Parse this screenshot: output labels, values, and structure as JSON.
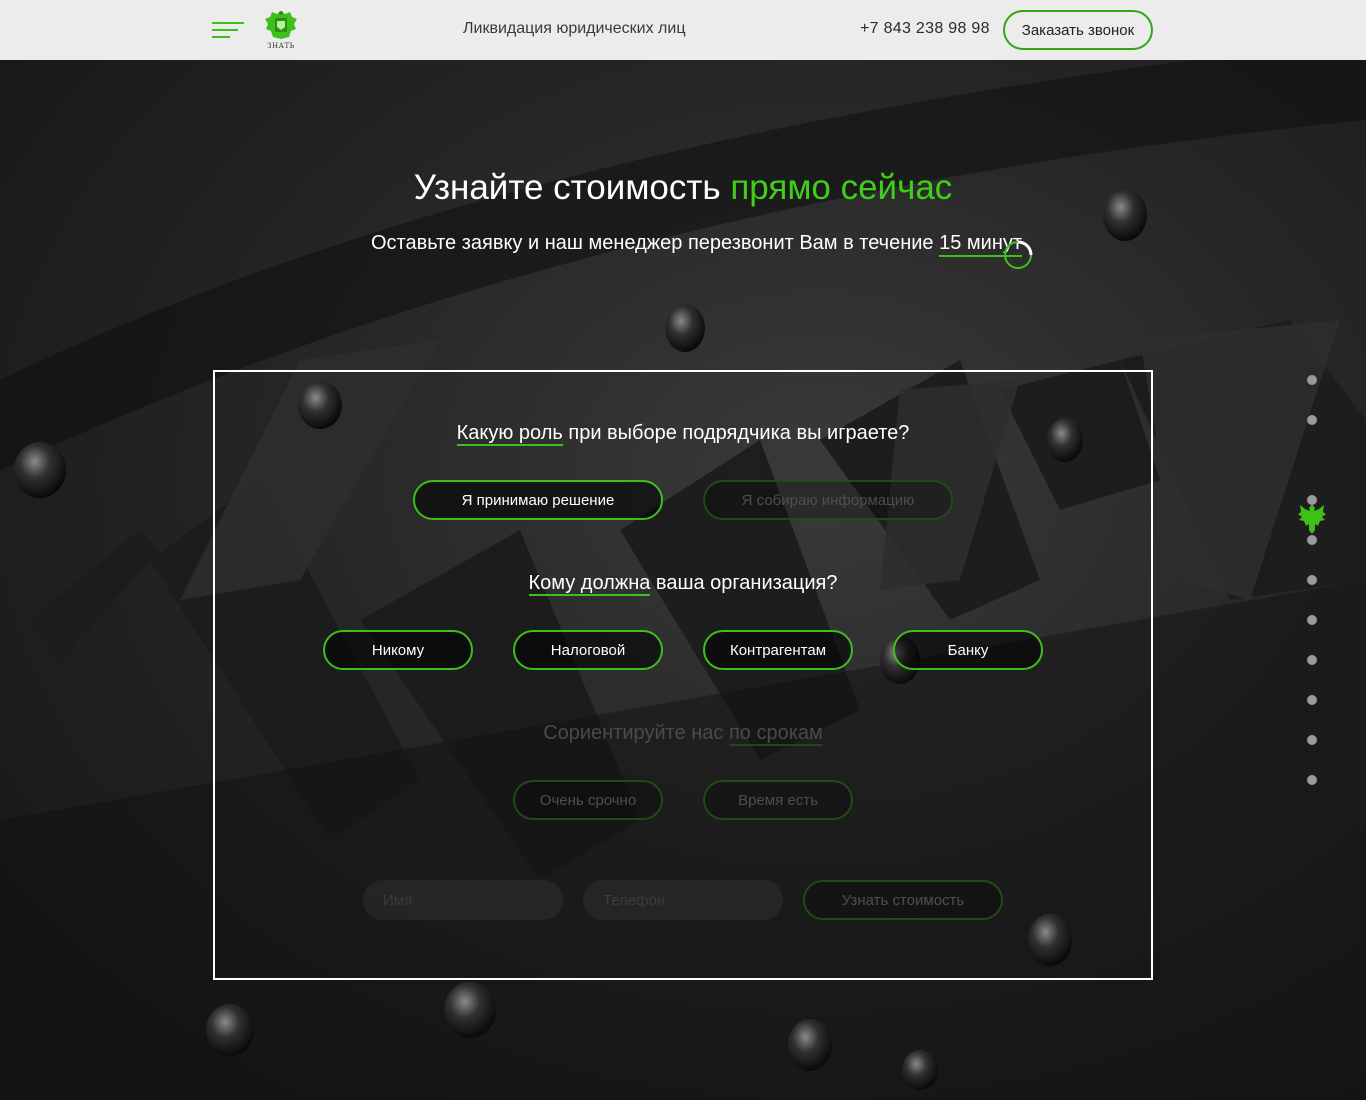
{
  "header": {
    "logo_text": "ЗНАТЬ",
    "tagline": "Ликвидация юридических лиц",
    "phone": "+7 843 238 98 98",
    "call_button": "Заказать звонок"
  },
  "hero": {
    "title_main": "Узнайте стоимость ",
    "title_accent": "прямо сейчас",
    "subtitle_main": "Оставьте заявку и наш менеджер перезвонит Вам в течение",
    "subtitle_highlight": "15 минут"
  },
  "quiz": {
    "q1": {
      "highlight": "Какую роль",
      "rest": " при выборе подрядчика вы играете?",
      "options": [
        "Я принимаю решение",
        "Я собираю информацию"
      ]
    },
    "q2": {
      "highlight": "Кому должна",
      "rest": " ваша организация?",
      "options": [
        "Никому",
        "Налоговой",
        "Контрагентам",
        "Банку"
      ]
    },
    "q3": {
      "text": "Сориентируйте нас ",
      "highlight": "по срокам",
      "options": [
        "Очень срочно",
        "Время есть"
      ]
    },
    "form": {
      "name_placeholder": "Имя",
      "phone_placeholder": "Телефон",
      "submit": "Узнать стоимость"
    }
  },
  "side_nav": {
    "dot_count": 11,
    "active_index": 2,
    "active_icon": "eagle-icon"
  },
  "colors": {
    "accent": "#3fbf1c",
    "header_bg": "#ececec",
    "box_border": "#ffffff"
  }
}
